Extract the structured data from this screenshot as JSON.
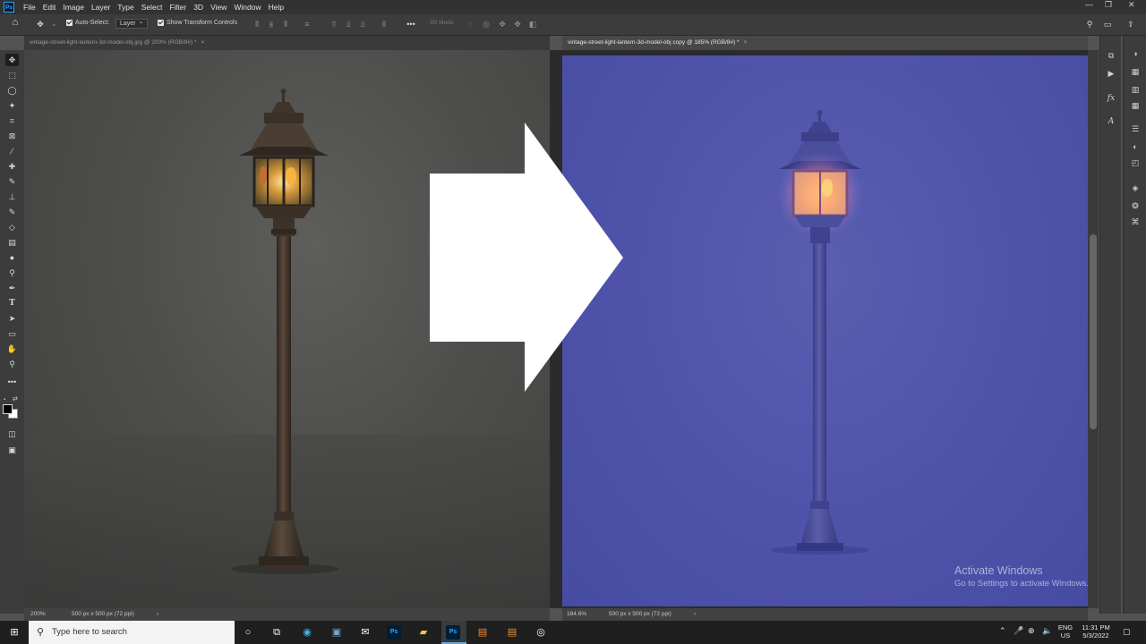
{
  "menubar": {
    "items": [
      "File",
      "Edit",
      "Image",
      "Layer",
      "Type",
      "Select",
      "Filter",
      "3D",
      "View",
      "Window",
      "Help"
    ]
  },
  "options": {
    "auto_select_label": "Auto-Select:",
    "auto_select_value": "Layer",
    "show_transform_label": "Show Transform Controls",
    "mode_3d_label": "3D Mode:",
    "more": "•••"
  },
  "documents": {
    "left_tab": "vintage-street-light-lantern-3d-model-obj.jpg @ 200% (RGB/8#) *",
    "right_tab": "vintage-street-light-lantern-3d-model-obj copy @ 185% (RGB/8#) *",
    "close": "×"
  },
  "status": {
    "left_zoom": "200%",
    "left_info": "500 px x 500 px (72 ppi)",
    "right_zoom": "184.6%",
    "right_info": "500 px x 500 px (72 ppi)",
    "arrow": "›"
  },
  "watermark": {
    "line1": "Activate Windows",
    "line2": "Go to Settings to activate Windows."
  },
  "taskbar": {
    "search_placeholder": "Type here to search",
    "ps1": "Ps",
    "ps2": "Ps",
    "lang1": "ENG",
    "lang2": "US",
    "time": "11:31 PM",
    "date": "5/3/2022"
  },
  "icons": {
    "ps_logo": "Ps",
    "fx": "fx"
  },
  "colors": {
    "ps_blue": "#31a8ff",
    "right_canvas": "#4f54aa",
    "lamp_glow": "#ffb070"
  }
}
